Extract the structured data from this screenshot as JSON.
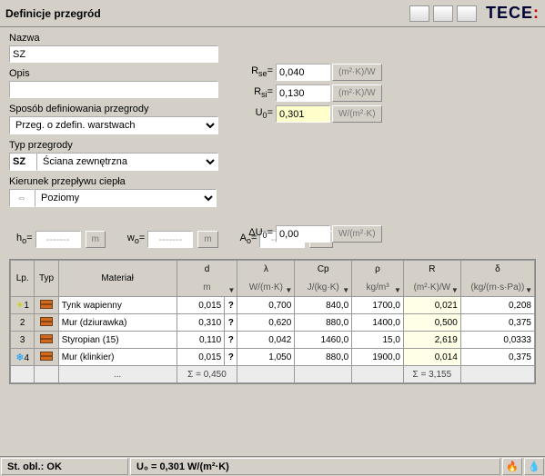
{
  "title": "Definicje przegród",
  "logo": "TECE",
  "form": {
    "name_label": "Nazwa",
    "name_value": "SZ",
    "desc_label": "Opis",
    "desc_value": "",
    "def_label": "Sposób definiowania przegrody",
    "def_value": "Przeg. o zdefin. warstwach",
    "type_label": "Typ przegrody",
    "type_code": "SZ",
    "type_value": "Ściana zewnętrzna",
    "flow_label": "Kierunek przepływu ciepła",
    "flow_value": "Poziomy"
  },
  "coef": {
    "rse_label": "Rse=",
    "rse_value": "0,040",
    "rse_unit": "(m²·K)/W",
    "rsi_label": "Rsi=",
    "rsi_value": "0,130",
    "rsi_unit": "(m²·K)/W",
    "u0_label": "U₀=",
    "u0_value": "0,301",
    "u0_unit": "W/(m²·K)",
    "du0_label": "ΔU₀=",
    "du0_value": "0,00",
    "du0_unit": "W/(m²·K)"
  },
  "dims": {
    "h_label": "h₀=",
    "h_val": "-------",
    "h_unit": "m",
    "w_label": "w₀=",
    "w_val": "-------",
    "w_unit": "m",
    "a_label": "A₀=",
    "a_val": "-------",
    "a_unit": "m²"
  },
  "grid": {
    "headers": {
      "lp": "Lp.",
      "typ": "Typ",
      "mat": "Materiał",
      "d": "d",
      "d_u": "m",
      "lam": "λ",
      "lam_u": "W/(m·K)",
      "cp": "Cp",
      "cp_u": "J/(kg·K)",
      "rho": "ρ",
      "rho_u": "kg/m³",
      "r": "R",
      "r_u": "(m²·K)/W",
      "del": "δ",
      "del_u": "(kg/(m·s·Pa))"
    },
    "rows": [
      {
        "lp": "1",
        "mat": "Tynk wapienny",
        "d": "0,015",
        "lam": "0,700",
        "cp": "840,0",
        "rho": "1700,0",
        "r": "0,021",
        "del": "0,208"
      },
      {
        "lp": "2",
        "mat": "Mur (dziurawka)",
        "d": "0,310",
        "lam": "0,620",
        "cp": "880,0",
        "rho": "1400,0",
        "r": "0,500",
        "del": "0,375"
      },
      {
        "lp": "3",
        "mat": "Styropian (15)",
        "d": "0,110",
        "lam": "0,042",
        "cp": "1460,0",
        "rho": "15,0",
        "r": "2,619",
        "del": "0,0333"
      },
      {
        "lp": "4",
        "mat": "Mur (klinkier)",
        "d": "0,015",
        "lam": "1,050",
        "cp": "880,0",
        "rho": "1900,0",
        "r": "0,014",
        "del": "0,375"
      }
    ],
    "sum": {
      "d": "Σ = 0,450",
      "r": "Σ = 3,155"
    }
  },
  "status": {
    "ok": "St. obl.: OK",
    "u": "U₀ = 0,301 W/(m²·K)"
  }
}
